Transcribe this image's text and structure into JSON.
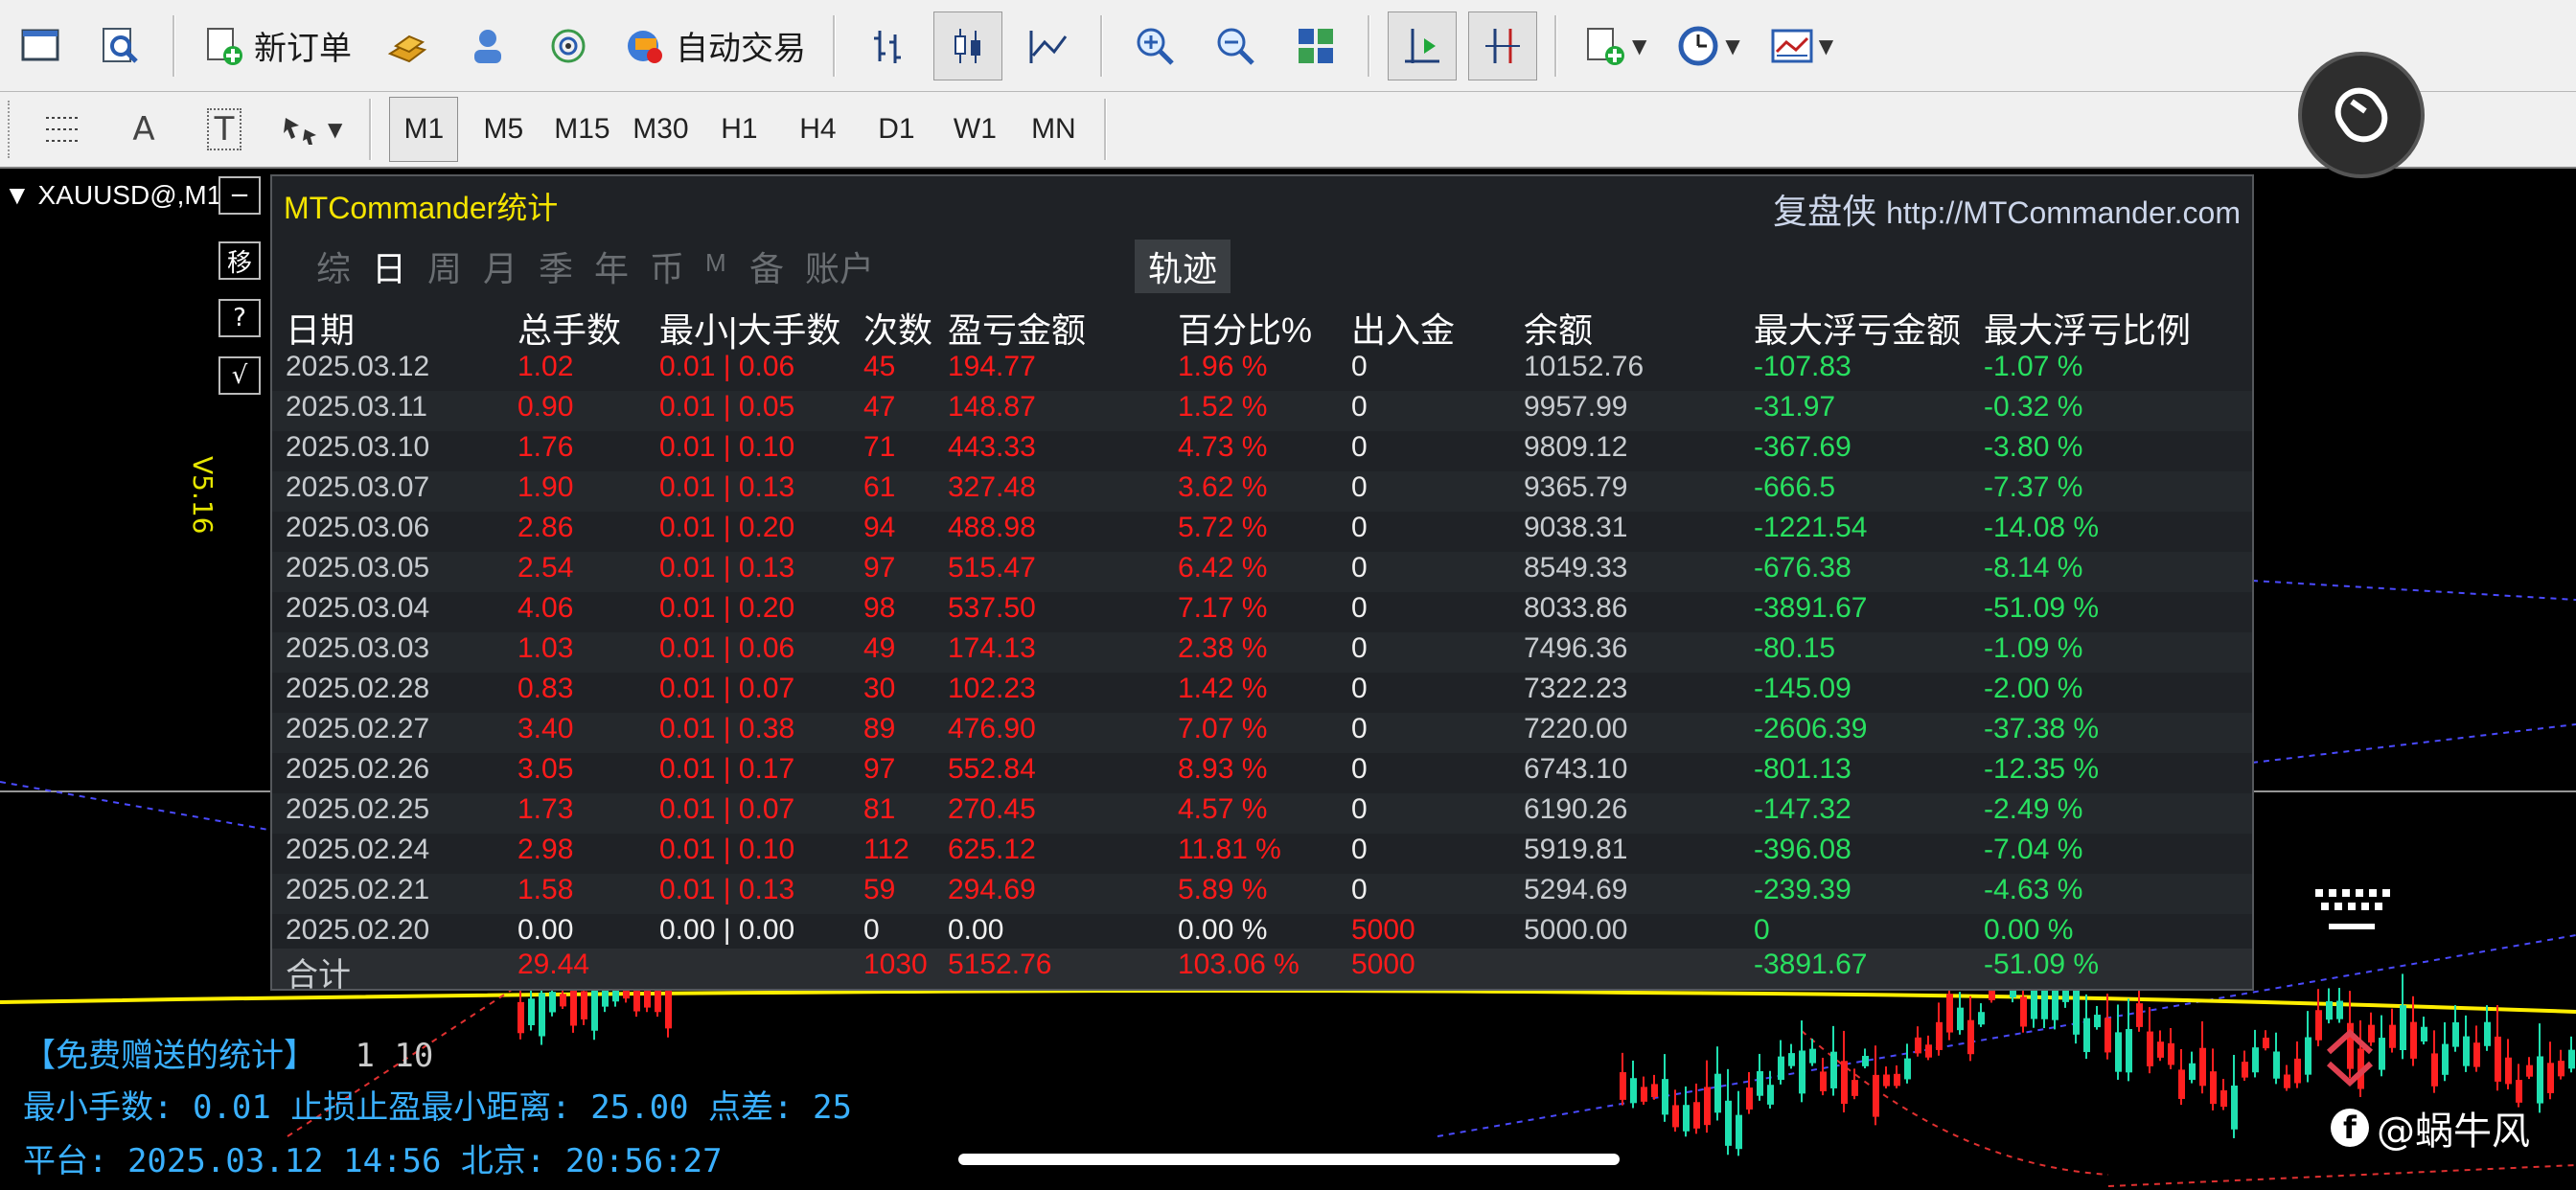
{
  "toolbar1": {
    "new_order": "新订单",
    "auto_trade": "自动交易"
  },
  "toolbar2": {
    "timeframes": [
      "M1",
      "M5",
      "M15",
      "M30",
      "H1",
      "H4",
      "D1",
      "W1",
      "MN"
    ],
    "active_timeframe": "M1",
    "text_tool": "A",
    "label_tool": "T"
  },
  "chart": {
    "symbol": "XAUUSD@,M1",
    "side_buttons": [
      "−",
      "移",
      "?",
      "√"
    ],
    "version": "V5.16"
  },
  "panel": {
    "title": "MTCommander统计",
    "brand": "复盘侠",
    "url": "http://MTCommander.com",
    "tabs": [
      "综",
      "日",
      "周",
      "月",
      "季",
      "年",
      "币",
      "M",
      "备",
      "账户"
    ],
    "active_tab": "日",
    "track_label": "轨迹",
    "headers": [
      "日期",
      "总手数",
      "最小|大手数",
      "次数",
      "盈亏金额",
      "百分比%",
      "出入金",
      "余额",
      "最大浮亏金额",
      "最大浮亏比例"
    ],
    "rows": [
      [
        "2025.03.12",
        "1.02",
        "0.01 | 0.06",
        "45",
        "194.77",
        "1.96 %",
        "0",
        "10152.76",
        "-107.83",
        "-1.07 %"
      ],
      [
        "2025.03.11",
        "0.90",
        "0.01 | 0.05",
        "47",
        "148.87",
        "1.52 %",
        "0",
        "9957.99",
        "-31.97",
        "-0.32 %"
      ],
      [
        "2025.03.10",
        "1.76",
        "0.01 | 0.10",
        "71",
        "443.33",
        "4.73 %",
        "0",
        "9809.12",
        "-367.69",
        "-3.80 %"
      ],
      [
        "2025.03.07",
        "1.90",
        "0.01 | 0.13",
        "61",
        "327.48",
        "3.62 %",
        "0",
        "9365.79",
        "-666.5",
        "-7.37 %"
      ],
      [
        "2025.03.06",
        "2.86",
        "0.01 | 0.20",
        "94",
        "488.98",
        "5.72 %",
        "0",
        "9038.31",
        "-1221.54",
        "-14.08 %"
      ],
      [
        "2025.03.05",
        "2.54",
        "0.01 | 0.13",
        "97",
        "515.47",
        "6.42 %",
        "0",
        "8549.33",
        "-676.38",
        "-8.14 %"
      ],
      [
        "2025.03.04",
        "4.06",
        "0.01 | 0.20",
        "98",
        "537.50",
        "7.17 %",
        "0",
        "8033.86",
        "-3891.67",
        "-51.09 %"
      ],
      [
        "2025.03.03",
        "1.03",
        "0.01 | 0.06",
        "49",
        "174.13",
        "2.38 %",
        "0",
        "7496.36",
        "-80.15",
        "-1.09 %"
      ],
      [
        "2025.02.28",
        "0.83",
        "0.01 | 0.07",
        "30",
        "102.23",
        "1.42 %",
        "0",
        "7322.23",
        "-145.09",
        "-2.00 %"
      ],
      [
        "2025.02.27",
        "3.40",
        "0.01 | 0.38",
        "89",
        "476.90",
        "7.07 %",
        "0",
        "7220.00",
        "-2606.39",
        "-37.38 %"
      ],
      [
        "2025.02.26",
        "3.05",
        "0.01 | 0.17",
        "97",
        "552.84",
        "8.93 %",
        "0",
        "6743.10",
        "-801.13",
        "-12.35 %"
      ],
      [
        "2025.02.25",
        "1.73",
        "0.01 | 0.07",
        "81",
        "270.45",
        "4.57 %",
        "0",
        "6190.26",
        "-147.32",
        "-2.49 %"
      ],
      [
        "2025.02.24",
        "2.98",
        "0.01 | 0.10",
        "112",
        "625.12",
        "11.81 %",
        "0",
        "5919.81",
        "-396.08",
        "-7.04 %"
      ],
      [
        "2025.02.21",
        "1.58",
        "0.01 | 0.13",
        "59",
        "294.69",
        "5.89 %",
        "0",
        "5294.69",
        "-239.39",
        "-4.63 %"
      ],
      [
        "2025.02.20",
        "0.00",
        "0.00 | 0.00",
        "0",
        "0.00",
        "0.00 %",
        "5000",
        "5000.00",
        "0",
        "0.00 %"
      ]
    ],
    "total": {
      "label": "合计",
      "lots": "29.44",
      "count": "1030",
      "pnl": "5152.76",
      "percent": "103.06 %",
      "deposit": "5000",
      "max_float_loss": "-3891.67",
      "max_float_ratio": "-51.09 %"
    }
  },
  "info": {
    "line1": "【免费赠送的统计】",
    "line1_suffix": "1   10",
    "line2": "最小手数: 0.01  止损止盈最小距离: 25.00  点差: 25",
    "line3": "平台: 2025.03.12 14:56  北京: 20:56:27"
  },
  "watermark": "@蜗牛风",
  "colors": {
    "loss": "#28e060",
    "profit": "#ff1a1a",
    "title": "#f5e400",
    "info": "#3ab0ff"
  }
}
